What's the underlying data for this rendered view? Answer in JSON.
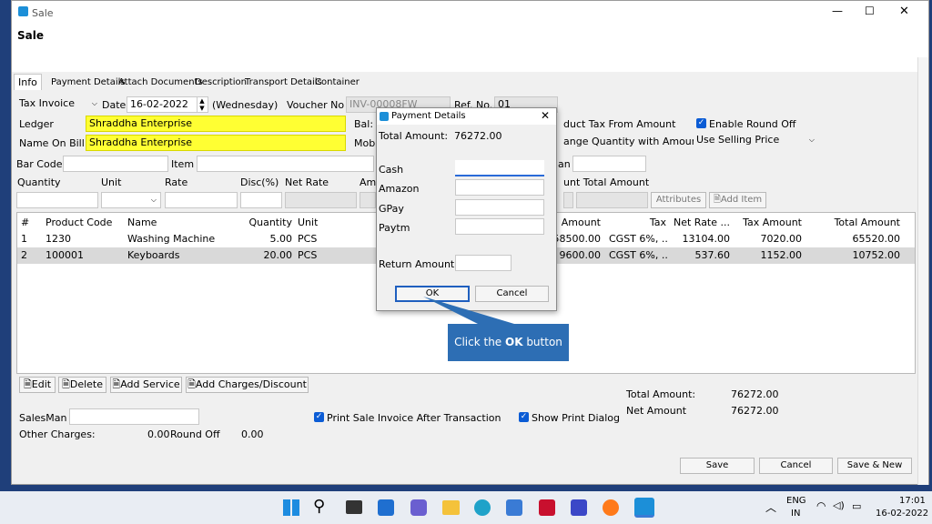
{
  "window": {
    "title": "Sale",
    "heading": "Sale"
  },
  "tabs": [
    "Info",
    "Payment Details",
    "Attach Documents",
    "Description",
    "Transport Details",
    "Container"
  ],
  "form": {
    "invoice_type": "Tax Invoice",
    "date_label": "Date",
    "date": "16-02-2022",
    "weekday": "(Wednesday)",
    "voucher_label": "Voucher No",
    "voucher": "INV-00008FW",
    "ref_label": "Ref. No.",
    "ref": "01",
    "ledger_label": "Ledger",
    "ledger": "Shraddha Enterprise",
    "bal_label": "Bal:",
    "name_label": "Name On Bill",
    "name": "Shraddha Enterprise",
    "mob_label": "Mob",
    "deduct_label": "duct Tax From Amount",
    "round_off_label": "Enable Round Off",
    "change_qty_label": "ange Quantity with Amount",
    "selling_price": "Use Selling Price",
    "barcode_label": "Bar Code",
    "item_label": "Item",
    "an_label": "an",
    "qty_label": "Quantity",
    "unit_label": "Unit",
    "rate_label": "Rate",
    "disc_label": "Disc(%)",
    "netrate_label": "Net Rate",
    "am_label": "Am",
    "unt_total_label": "unt Total Amount",
    "attributes_btn": "Attributes",
    "add_item_btn": "Add Item"
  },
  "grid": {
    "headers": [
      "#",
      "Product Code",
      "Name",
      "Quantity",
      "Unit",
      "Amount",
      "Tax",
      "Net Rate ...",
      "Tax Amount",
      "Total Amount"
    ],
    "rows": [
      [
        "1",
        "1230",
        "Washing Machine",
        "5.00",
        "PCS",
        "58500.00",
        "CGST 6%, ...",
        "13104.00",
        "7020.00",
        "65520.00"
      ],
      [
        "2",
        "100001",
        "Keyboards",
        "20.00",
        "PCS",
        "9600.00",
        "CGST 6%, ...",
        "537.60",
        "1152.00",
        "10752.00"
      ]
    ]
  },
  "actions": {
    "edit": "Edit",
    "delete": "Delete",
    "add_service": "Add Service",
    "add_charges": "Add Charges/Discount"
  },
  "footer": {
    "salesman_label": "SalesMan",
    "other_charges_label": "Other Charges:",
    "other_charges": "0.00",
    "round_off_label": "Round Off",
    "round_off": "0.00",
    "print_invoice": "Print Sale Invoice After Transaction",
    "show_print": "Show Print Dialog",
    "total_label": "Total Amount:",
    "total": "76272.00",
    "net_label": "Net Amount",
    "net": "76272.00",
    "save": "Save",
    "cancel": "Cancel",
    "save_new": "Save & New"
  },
  "dialog": {
    "title": "Payment Details",
    "total_label": "Total Amount:",
    "total": "76272.00",
    "fields": [
      "Cash",
      "Amazon",
      "GPay",
      "Paytm"
    ],
    "return_label": "Return Amount",
    "ok": "OK",
    "cancel": "Cancel"
  },
  "callout": {
    "prefix": "Click the ",
    "bold": "OK",
    "suffix": " button"
  },
  "taskbar": {
    "lang1": "ENG",
    "lang2": "IN",
    "time": "17:01",
    "date": "16-02-2022"
  }
}
